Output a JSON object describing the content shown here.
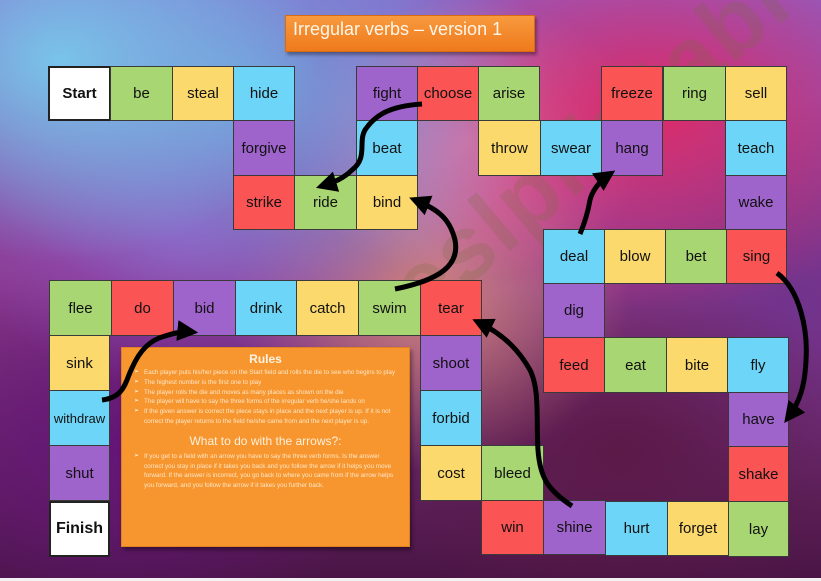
{
  "title": "Irregular verbs – version 1",
  "colors": {
    "white": "#ffffff",
    "green": "#a8d672",
    "yellow": "#fcd96c",
    "blue": "#6dd6f8",
    "purple": "#9f63cc",
    "red": "#fb5454",
    "orange_panel": "#f7962e"
  },
  "board": {
    "start": "Start",
    "finish": "Finish",
    "cells": [
      {
        "word": "be",
        "color": "green"
      },
      {
        "word": "steal",
        "color": "yellow"
      },
      {
        "word": "hide",
        "color": "blue"
      },
      {
        "word": "forgive",
        "color": "purple"
      },
      {
        "word": "strike",
        "color": "red"
      },
      {
        "word": "ride",
        "color": "green"
      },
      {
        "word": "bind",
        "color": "yellow"
      },
      {
        "word": "beat",
        "color": "blue"
      },
      {
        "word": "fight",
        "color": "purple"
      },
      {
        "word": "choose",
        "color": "red"
      },
      {
        "word": "arise",
        "color": "green"
      },
      {
        "word": "throw",
        "color": "yellow"
      },
      {
        "word": "swear",
        "color": "blue"
      },
      {
        "word": "hang",
        "color": "purple"
      },
      {
        "word": "freeze",
        "color": "red"
      },
      {
        "word": "ring",
        "color": "green"
      },
      {
        "word": "sell",
        "color": "yellow"
      },
      {
        "word": "teach",
        "color": "blue"
      },
      {
        "word": "wake",
        "color": "purple"
      },
      {
        "word": "sing",
        "color": "red"
      },
      {
        "word": "bet",
        "color": "green"
      },
      {
        "word": "blow",
        "color": "yellow"
      },
      {
        "word": "deal",
        "color": "blue"
      },
      {
        "word": "dig",
        "color": "purple"
      },
      {
        "word": "feed",
        "color": "red"
      },
      {
        "word": "eat",
        "color": "green"
      },
      {
        "word": "bite",
        "color": "yellow"
      },
      {
        "word": "fly",
        "color": "blue"
      },
      {
        "word": "have",
        "color": "purple"
      },
      {
        "word": "shake",
        "color": "red"
      },
      {
        "word": "lay",
        "color": "green"
      },
      {
        "word": "forget",
        "color": "yellow"
      },
      {
        "word": "hurt",
        "color": "blue"
      },
      {
        "word": "shine",
        "color": "purple"
      },
      {
        "word": "win",
        "color": "red"
      },
      {
        "word": "bleed",
        "color": "green"
      },
      {
        "word": "cost",
        "color": "yellow"
      },
      {
        "word": "forbid",
        "color": "blue"
      },
      {
        "word": "shoot",
        "color": "purple"
      },
      {
        "word": "tear",
        "color": "red"
      },
      {
        "word": "swim",
        "color": "green"
      },
      {
        "word": "catch",
        "color": "yellow"
      },
      {
        "word": "drink",
        "color": "blue"
      },
      {
        "word": "bid",
        "color": "purple"
      },
      {
        "word": "do",
        "color": "red"
      },
      {
        "word": "flee",
        "color": "green"
      },
      {
        "word": "sink",
        "color": "yellow"
      },
      {
        "word": "withdraw",
        "color": "blue"
      },
      {
        "word": "shut",
        "color": "purple"
      }
    ],
    "arrows": [
      {
        "from": "choose",
        "to": "ride"
      },
      {
        "from": "swim",
        "to": "bind"
      },
      {
        "from": "deal",
        "to": "hang"
      },
      {
        "from": "sing",
        "to": "have"
      },
      {
        "from": "shine",
        "to": "tear"
      },
      {
        "from": "withdraw",
        "to": "bid"
      }
    ]
  },
  "rules": {
    "heading": "Rules",
    "items": [
      "Each player puts his/her piece on the Start field and rolls the die to see who begins to play",
      "The highest number is the first one to play",
      "The player rolls the die and moves as many places as shown on the die",
      "The player will have to say the three forms of the irregular verb he/she lands on",
      "If the given answer is correct the piece stays in place and the next player is up. If it is not correct the player returns to the field he/she came from and the next player is up."
    ],
    "arrows_heading": "What to do with the arrows?:",
    "arrows_items": [
      "If you get to a field with an arrow you have to say the three verb forms. Is the answer correct you stay in place if it takes you back and you follow the arrow if it helps you move forward. If the answer is incorrect, you go back to where you came from if the arrow helps you forward, and you follow the arrow if it takes you further back."
    ]
  },
  "watermark": "eslprintables.com"
}
